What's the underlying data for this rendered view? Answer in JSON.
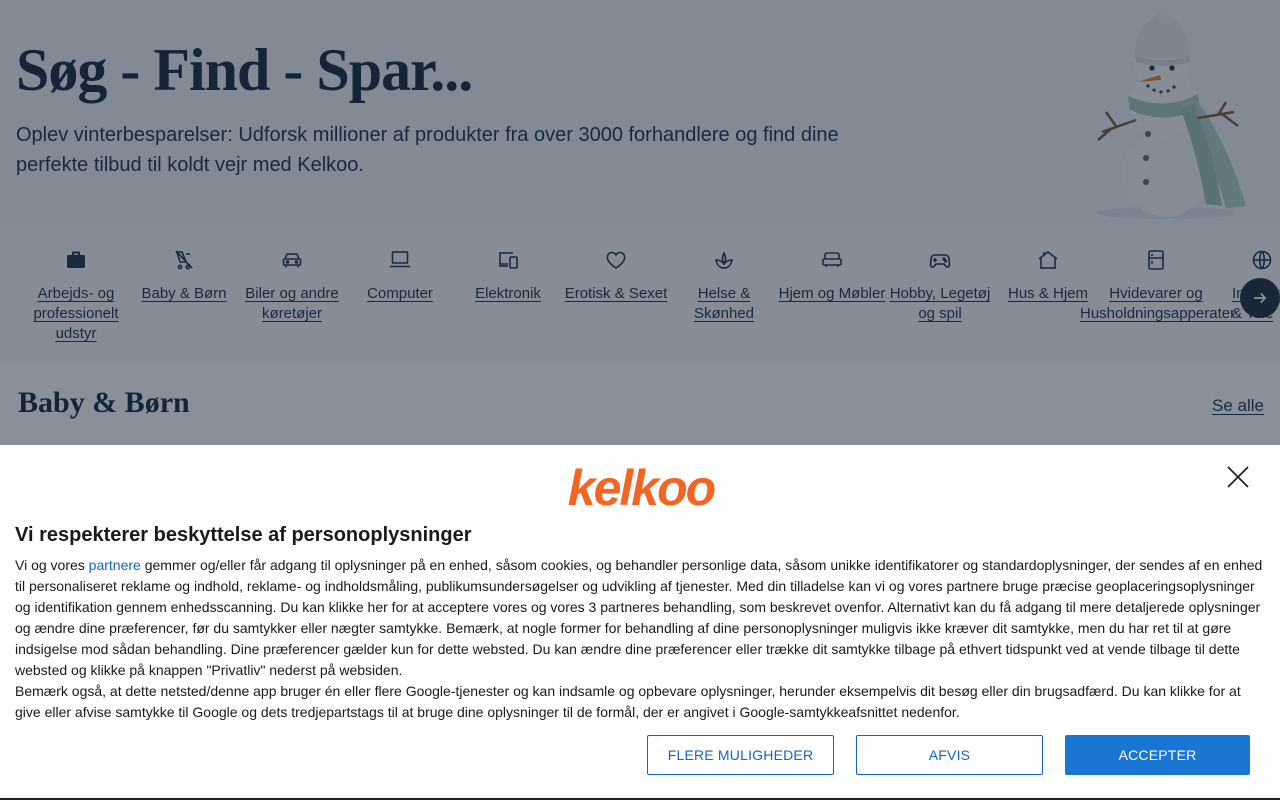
{
  "hero": {
    "title": "Søg - Find - Spar...",
    "subtitle": "Oplev vinterbesparelser: Udforsk millioner af produkter fra over 3000 forhandlere og find dine perfekte tilbud til koldt vejr med Kelkoo."
  },
  "categories": [
    {
      "label": "Arbejds- og professionelt udstyr",
      "icon": "briefcase-icon"
    },
    {
      "label": "Baby & Børn",
      "icon": "stroller-icon"
    },
    {
      "label": "Biler og andre køretøjer",
      "icon": "car-icon"
    },
    {
      "label": "Computer",
      "icon": "laptop-icon"
    },
    {
      "label": "Elektronik",
      "icon": "devices-icon"
    },
    {
      "label": "Erotisk & Sexet",
      "icon": "heart-icon"
    },
    {
      "label": "Helse & Skønhed",
      "icon": "lotus-icon"
    },
    {
      "label": "Hjem og Møbler",
      "icon": "sofa-icon"
    },
    {
      "label": "Hobby, Legetøj og spil",
      "icon": "gamepad-icon"
    },
    {
      "label": "Hus & Hjem",
      "icon": "house-icon"
    },
    {
      "label": "Hvidevarer og Husholdningsapperater",
      "icon": "fridge-icon"
    },
    {
      "label": "Internet & Tele",
      "icon": "globe-icon"
    }
  ],
  "section": {
    "title": "Baby & Børn",
    "see_all": "Se alle"
  },
  "consent": {
    "logo_text": "kelkoo",
    "title": "Vi respekterer beskyttelse af personoplysninger",
    "p1_before": "Vi og vores ",
    "p1_link": "partnere",
    "p1_after": " gemmer og/eller får adgang til oplysninger på en enhed, såsom cookies, og behandler personlige data, såsom unikke identifikatorer og standardoplysninger, der sendes af en enhed til personaliseret reklame og indhold, reklame- og indholdsmåling, publikumsundersøgelser og udvikling af tjenester. Med din tilladelse kan vi og vores partnere bruge præcise geoplaceringsoplysninger og identifikation gennem enhedsscanning. Du kan klikke her for at acceptere vores og vores 3 partneres behandling, som beskrevet ovenfor. Alternativt kan du få adgang til mere detaljerede oplysninger og ændre dine præferencer, før du samtykker eller nægter samtykke. Bemærk, at nogle former for behandling af dine personoplysninger muligvis ikke kræver dit samtykke, men du har ret til at gøre indsigelse mod sådan behandling. Dine præferencer gælder kun for dette websted. Du kan ændre dine præferencer eller trække dit samtykke tilbage på ethvert tidspunkt ved at vende tilbage til dette websted og klikke på knappen \"Privatliv\" nederst på websiden.",
    "p2": "Bemærk også, at dette netsted/denne app bruger én eller flere Google-tjenester og kan indsamle og opbevare oplysninger, herunder eksempelvis dit besøg eller din brugsadfærd. Du kan klikke for at give eller afvise samtykke til Google og dets tredjepartstags til at bruge dine oplysninger til de formål, der er angivet i Google-samtykkeafsnittet nedenfor.",
    "btn_more": "FLERE MULIGHEDER",
    "btn_deny": "AFVIS",
    "btn_accept": "ACCEPTER"
  },
  "colors": {
    "brand": "#f26522",
    "accent": "#1976d2",
    "overlay": "#162234"
  }
}
